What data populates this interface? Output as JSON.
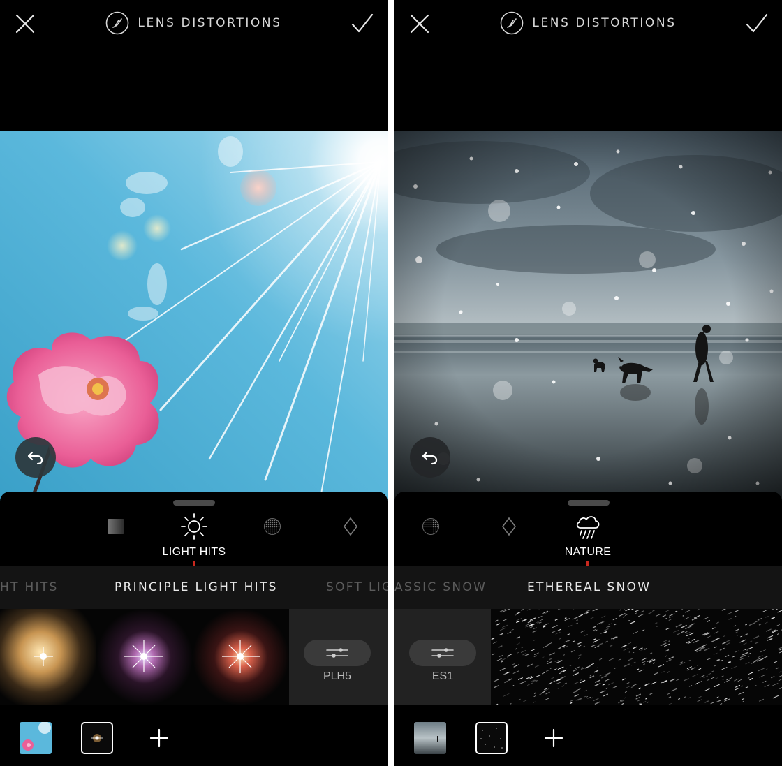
{
  "left": {
    "title": "LENS DISTORTIONS",
    "category_label": "LIGHT HITS",
    "categories": [
      {
        "icon": "gradient-square-icon"
      },
      {
        "icon": "sun-icon",
        "active": true
      },
      {
        "icon": "dotted-circle-icon"
      },
      {
        "icon": "diamond-icon"
      }
    ],
    "subcategories": [
      {
        "label": "HT HITS"
      },
      {
        "label": "PRINCIPLE LIGHT HITS",
        "active": true
      },
      {
        "label": "SOFT LIGI"
      }
    ],
    "adjust_label": "PLH5",
    "icons": {
      "close": "close-icon",
      "confirm": "checkmark-icon",
      "undo": "undo-icon",
      "add": "plus-icon",
      "adjust": "sliders-icon"
    }
  },
  "right": {
    "title": "LENS DISTORTIONS",
    "category_label": "NATURE",
    "categories": [
      {
        "icon": "dotted-circle-icon"
      },
      {
        "icon": "diamond-icon"
      },
      {
        "icon": "rain-cloud-icon",
        "active": true
      }
    ],
    "subcategories": [
      {
        "label": "ASSIC SNOW"
      },
      {
        "label": "ETHEREAL SNOW",
        "active": true
      }
    ],
    "adjust_label": "ES1",
    "icons": {
      "close": "close-icon",
      "confirm": "checkmark-icon",
      "undo": "undo-icon",
      "add": "plus-icon",
      "adjust": "sliders-icon"
    }
  },
  "colors": {
    "accent_marker": "#c8281e",
    "panel": "#000000",
    "subbar": "#141414",
    "adjust_tile": "#222222"
  }
}
